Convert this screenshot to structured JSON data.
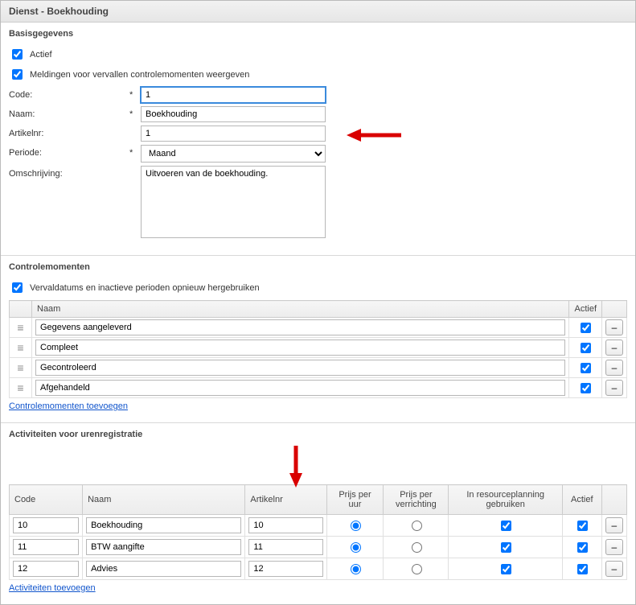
{
  "header": {
    "title": "Dienst - Boekhouding"
  },
  "basis": {
    "title": "Basisgegevens",
    "actief_label": "Actief",
    "actief": true,
    "meldingen_label": "Meldingen voor vervallen controlemomenten weergeven",
    "meldingen": true,
    "code_label": "Code:",
    "code": "1",
    "naam_label": "Naam:",
    "naam": "Boekhouding",
    "artikelnr_label": "Artikelnr:",
    "artikelnr": "1",
    "periode_label": "Periode:",
    "periode": "Maand",
    "omschrijving_label": "Omschrijving:",
    "omschrijving": "Uitvoeren van de boekhouding.",
    "req": "*"
  },
  "cm": {
    "title": "Controlemomenten",
    "reuse_label": "Vervaldatums en inactieve perioden opnieuw hergebruiken",
    "reuse": true,
    "col_naam": "Naam",
    "col_actief": "Actief",
    "rows": [
      {
        "naam": "Gegevens aangeleverd",
        "actief": true
      },
      {
        "naam": "Compleet",
        "actief": true
      },
      {
        "naam": "Gecontroleerd",
        "actief": true
      },
      {
        "naam": "Afgehandeld",
        "actief": true
      }
    ],
    "add_link": "Controlemomenten toevoegen"
  },
  "act": {
    "title": "Activiteiten voor urenregistratie",
    "col_code": "Code",
    "col_naam": "Naam",
    "col_art": "Artikelnr",
    "col_ppu": "Prijs per uur",
    "col_ppv": "Prijs per verrichting",
    "col_plan": "In resourceplanning gebruiken",
    "col_act": "Actief",
    "rows": [
      {
        "code": "10",
        "naam": "Boekhouding",
        "art": "10",
        "pricemode": "uur",
        "inplan": true,
        "actief": true
      },
      {
        "code": "11",
        "naam": "BTW aangifte",
        "art": "11",
        "pricemode": "uur",
        "inplan": true,
        "actief": true
      },
      {
        "code": "12",
        "naam": "Advies",
        "art": "12",
        "pricemode": "uur",
        "inplan": true,
        "actief": true
      }
    ],
    "add_link": "Activiteiten toevoegen"
  },
  "icons": {
    "drag": "≡",
    "minus": "–"
  }
}
